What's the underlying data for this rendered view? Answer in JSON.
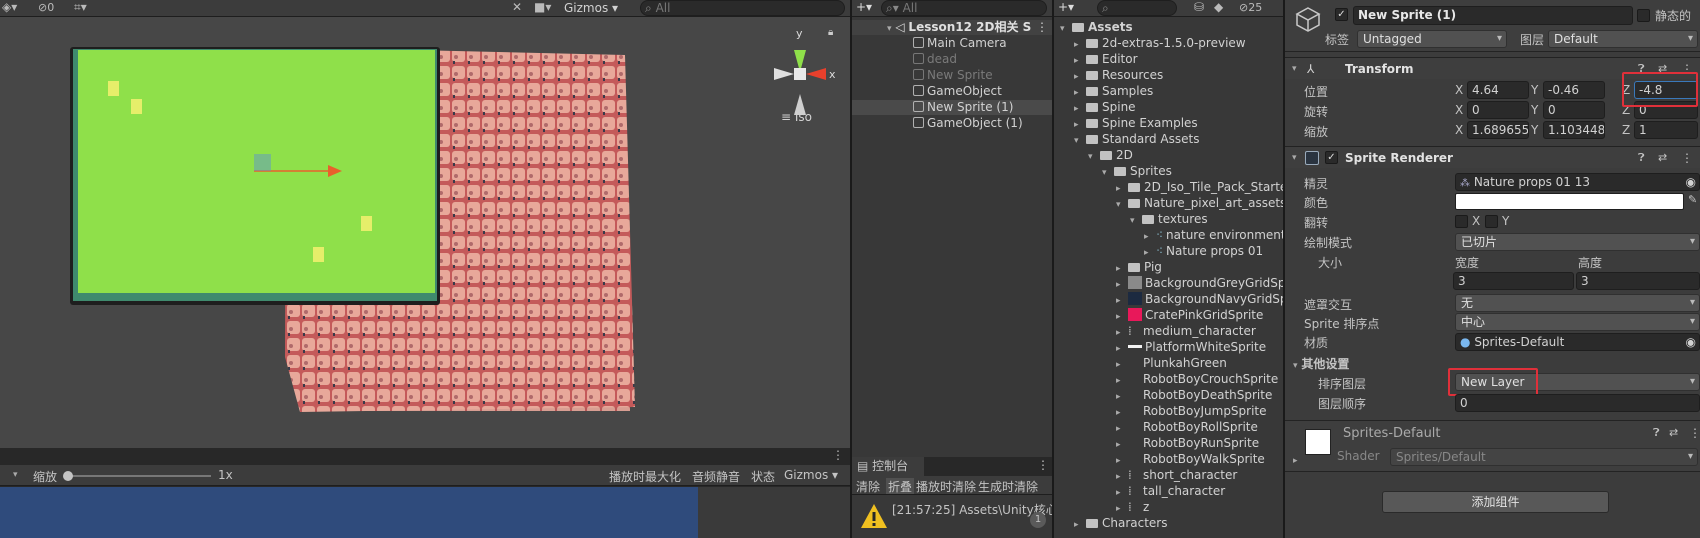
{
  "scene_toolbar": {
    "hidden_count": "0",
    "gizmos_label": "Gizmos",
    "search_placeholder": "All"
  },
  "scene_view": {
    "iso_label": "Iso",
    "gizmo_y": "y",
    "gizmo_x": "x"
  },
  "game_toolbar": {
    "scale_label": "缩放",
    "scale_value": "1x",
    "maximize_label": "播放时最大化",
    "mute_label": "音频静音",
    "stats_label": "状态",
    "gizmos_label": "Gizmos"
  },
  "hierarchy": {
    "search_placeholder": "All",
    "scene_name": "Lesson12 2D相关 S",
    "items": [
      {
        "label": "Main Camera",
        "dim": false,
        "selected": false
      },
      {
        "label": "dead",
        "dim": true,
        "selected": false
      },
      {
        "label": "New Sprite",
        "dim": true,
        "selected": false
      },
      {
        "label": "GameObject",
        "dim": false,
        "selected": false
      },
      {
        "label": "New Sprite (1)",
        "dim": false,
        "selected": true
      },
      {
        "label": "GameObject (1)",
        "dim": false,
        "selected": false
      }
    ]
  },
  "console": {
    "tab_label": "控制台",
    "buttons": [
      "清除",
      "折叠",
      "播放时清除",
      "生成时清除"
    ],
    "message": "[21:57:25] Assets\\Unity核心\\",
    "badge": "1"
  },
  "project": {
    "count": "25",
    "items": [
      {
        "label": "Assets",
        "depth": 0,
        "open": true,
        "bold": true,
        "icon": "folder"
      },
      {
        "label": "2d-extras-1.5.0-preview",
        "depth": 1,
        "open": false,
        "icon": "folder"
      },
      {
        "label": "Editor",
        "depth": 1,
        "open": false,
        "icon": "folder"
      },
      {
        "label": "Resources",
        "depth": 1,
        "open": false,
        "icon": "folder"
      },
      {
        "label": "Samples",
        "depth": 1,
        "open": false,
        "icon": "folder"
      },
      {
        "label": "Spine",
        "depth": 1,
        "open": false,
        "icon": "folder"
      },
      {
        "label": "Spine Examples",
        "depth": 1,
        "open": false,
        "icon": "folder"
      },
      {
        "label": "Standard Assets",
        "depth": 1,
        "open": true,
        "icon": "folder"
      },
      {
        "label": "2D",
        "depth": 2,
        "open": true,
        "icon": "folder"
      },
      {
        "label": "Sprites",
        "depth": 3,
        "open": true,
        "icon": "folder"
      },
      {
        "label": "2D_Iso_Tile_Pack_Starter",
        "depth": 4,
        "open": false,
        "icon": "folder"
      },
      {
        "label": "Nature_pixel_art_assets",
        "depth": 4,
        "open": true,
        "icon": "folder"
      },
      {
        "label": "textures",
        "depth": 5,
        "open": true,
        "icon": "folder"
      },
      {
        "label": "nature environment",
        "depth": 6,
        "open": false,
        "icon": "sprite"
      },
      {
        "label": "Nature props 01",
        "depth": 6,
        "open": false,
        "icon": "sprite"
      },
      {
        "label": "Pig",
        "depth": 4,
        "open": false,
        "icon": "folder"
      },
      {
        "label": "BackgroundGreyGridSp",
        "depth": 4,
        "open": false,
        "icon": "grey"
      },
      {
        "label": "BackgroundNavyGridSp",
        "depth": 4,
        "open": false,
        "icon": "navy"
      },
      {
        "label": "CratePinkGridSprite",
        "depth": 4,
        "open": false,
        "icon": "pink"
      },
      {
        "label": "medium_character",
        "depth": 4,
        "open": false,
        "icon": "char"
      },
      {
        "label": "PlatformWhiteSprite",
        "depth": 4,
        "open": false,
        "icon": "white"
      },
      {
        "label": "PlunkahGreen",
        "depth": 4,
        "open": false,
        "icon": "none"
      },
      {
        "label": "RobotBoyCrouchSprite",
        "depth": 4,
        "open": false,
        "icon": "none"
      },
      {
        "label": "RobotBoyDeathSprite",
        "depth": 4,
        "open": false,
        "icon": "none"
      },
      {
        "label": "RobotBoyJumpSprite",
        "depth": 4,
        "open": false,
        "icon": "none"
      },
      {
        "label": "RobotBoyRollSprite",
        "depth": 4,
        "open": false,
        "icon": "none"
      },
      {
        "label": "RobotBoyRunSprite",
        "depth": 4,
        "open": false,
        "icon": "none"
      },
      {
        "label": "RobotBoyWalkSprite",
        "depth": 4,
        "open": false,
        "icon": "none"
      },
      {
        "label": "short_character",
        "depth": 4,
        "open": false,
        "icon": "char"
      },
      {
        "label": "tall_character",
        "depth": 4,
        "open": false,
        "icon": "char"
      },
      {
        "label": "z",
        "depth": 4,
        "open": false,
        "icon": "char"
      },
      {
        "label": "Characters",
        "depth": 1,
        "open": false,
        "icon": "folder"
      }
    ]
  },
  "inspector": {
    "object_name": "New Sprite (1)",
    "static_label": "静态的",
    "tag_label": "标签",
    "tag_value": "Untagged",
    "layer_label": "图层",
    "layer_value": "Default",
    "transform": {
      "title": "Transform",
      "position_label": "位置",
      "pos_x": "4.64",
      "pos_y": "-0.46",
      "pos_z": "-4.8",
      "rotation_label": "旋转",
      "rot_x": "0",
      "rot_y": "0",
      "rot_z": "0",
      "scale_label": "缩放",
      "scl_x": "1.689655",
      "scl_y": "1.103448",
      "scl_z": "1"
    },
    "sprite_renderer": {
      "title": "Sprite Renderer",
      "sprite_label": "精灵",
      "sprite_value": "Nature props 01 13",
      "color_label": "颜色",
      "flip_label": "翻转",
      "flip_x": "X",
      "flip_y": "Y",
      "draw_mode_label": "绘制模式",
      "draw_mode_value": "已切片",
      "size_label": "大小",
      "width_label": "宽度",
      "height_label": "高度",
      "width_value": "3",
      "height_value": "3",
      "mask_label": "遮罩交互",
      "mask_value": "无",
      "sort_point_label": "Sprite 排序点",
      "sort_point_value": "中心",
      "material_label": "材质",
      "material_value": "Sprites-Default",
      "other_label": "其他设置",
      "sorting_layer_label": "排序图层",
      "sorting_layer_value": "New Layer",
      "order_label": "图层顺序",
      "order_value": "0"
    },
    "material": {
      "name": "Sprites-Default",
      "shader_label": "Shader",
      "shader_value": "Sprites/Default"
    },
    "add_component": "添加组件",
    "axis_x": "X",
    "axis_y": "Y",
    "axis_z": "Z"
  },
  "colors": {
    "accent_red": "#e0303a",
    "selection": "#2c5d87",
    "game_blue": "#2f4b7c",
    "grass": "#8fe04a",
    "pig": "#e8a89a"
  }
}
